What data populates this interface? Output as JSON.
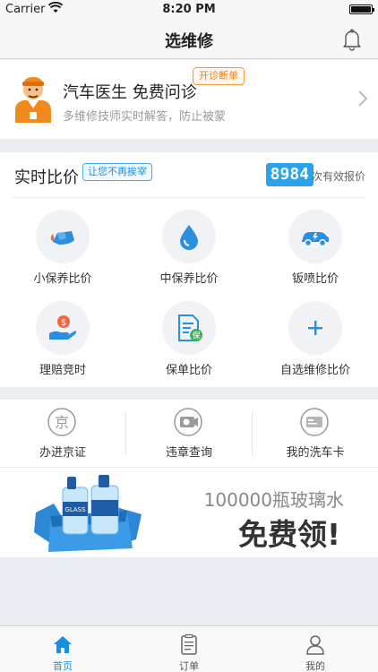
{
  "status_bar": {
    "carrier": "Carrier",
    "time": "8:20 PM"
  },
  "nav": {
    "title": "选维修"
  },
  "doctor": {
    "title": "汽车医生 免费问诊",
    "badge": "开诊断单",
    "description": "多维修技师实时解答，防止被蒙"
  },
  "compare": {
    "title": "实时比价",
    "tag": "让您不再挨宰",
    "count": "8984",
    "count_label": "次有效报价",
    "items": [
      {
        "label": "小保养比价",
        "icon": "oil-can-icon"
      },
      {
        "label": "中保养比价",
        "icon": "water-drop-icon"
      },
      {
        "label": "钣喷比价",
        "icon": "car-spray-icon"
      },
      {
        "label": "理赔竞时",
        "icon": "money-hand-icon"
      },
      {
        "label": "保单比价",
        "icon": "policy-document-icon"
      },
      {
        "label": "自选维修比价",
        "icon": "plus-icon"
      }
    ]
  },
  "services": [
    {
      "label": "办进京证",
      "icon": "jing-badge-icon"
    },
    {
      "label": "违章查询",
      "icon": "camera-icon"
    },
    {
      "label": "我的洗车卡",
      "icon": "card-icon"
    }
  ],
  "banner": {
    "line1": "100000瓶玻璃水",
    "line2": "免费领!"
  },
  "tabs": [
    {
      "label": "首页",
      "icon": "home-icon",
      "active": true
    },
    {
      "label": "订单",
      "icon": "clipboard-icon",
      "active": false
    },
    {
      "label": "我的",
      "icon": "user-icon",
      "active": false
    }
  ],
  "colors": {
    "accent": "#2ba3ea",
    "badge_orange": "#f07d11",
    "tab_active": "#1a8fe0"
  }
}
